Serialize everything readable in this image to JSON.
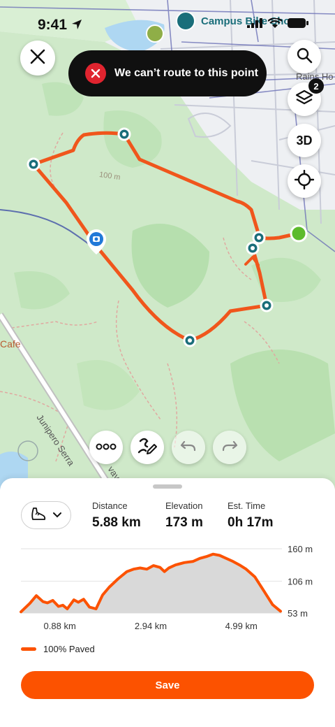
{
  "status_bar": {
    "time": "9:41"
  },
  "toast": {
    "message": "We can’t route to this point"
  },
  "map": {
    "labels": {
      "campus_bike_shop": "Campus Bike Shop",
      "rains_ho": "Rains Ho",
      "contour_100m": "100 m",
      "cafe": "Cafe",
      "road_junipero": "Junipero Serra",
      "road_way_suffix": "vay"
    },
    "layers_badge": "2",
    "btn_3d": "3D"
  },
  "stats": {
    "distance_label": "Distance",
    "distance_value": "5.88 km",
    "elevation_label": "Elevation",
    "elevation_value": "173 m",
    "time_label": "Est. Time",
    "time_value": "0h 17m"
  },
  "elevation_chart": {
    "y_ticks": [
      "160 m",
      "106 m",
      "53 m"
    ],
    "x_ticks": [
      "0.88 km",
      "2.94 km",
      "4.99 km"
    ]
  },
  "chart_data": {
    "type": "area",
    "x": [
      0.0,
      0.2,
      0.35,
      0.5,
      0.6,
      0.72,
      0.85,
      0.95,
      1.05,
      1.2,
      1.3,
      1.42,
      1.55,
      1.7,
      1.85,
      2.0,
      2.2,
      2.4,
      2.55,
      2.7,
      2.85,
      3.0,
      3.15,
      3.25,
      3.35,
      3.5,
      3.7,
      3.9,
      4.05,
      4.2,
      4.35,
      4.5,
      4.65,
      4.8,
      4.95,
      5.1,
      5.3,
      5.5,
      5.7,
      5.88
    ],
    "values": [
      55,
      69,
      82,
      72,
      70,
      74,
      64,
      66,
      60,
      75,
      71,
      76,
      63,
      60,
      83,
      96,
      110,
      122,
      126,
      128,
      126,
      132,
      129,
      122,
      128,
      133,
      137,
      139,
      144,
      147,
      151,
      149,
      144,
      139,
      133,
      126,
      113,
      90,
      67,
      56
    ],
    "xlabel": "",
    "ylabel": "",
    "ylim": [
      53,
      160
    ],
    "x_ticks": [
      0.88,
      2.94,
      4.99
    ],
    "y_ticks": [
      53,
      106,
      160
    ],
    "grid": true,
    "colors": {
      "line": "#fc5200",
      "fill": "#d9d9d9"
    }
  },
  "legend": {
    "label": "100% Paved"
  },
  "save": {
    "label": "Save"
  },
  "colors": {
    "accent": "#fc5200",
    "error": "#e0242f",
    "route": "#f0561c",
    "waypoint": "#1a6e7a",
    "start": "#5dbb2c",
    "park": "#c9e7c2"
  }
}
